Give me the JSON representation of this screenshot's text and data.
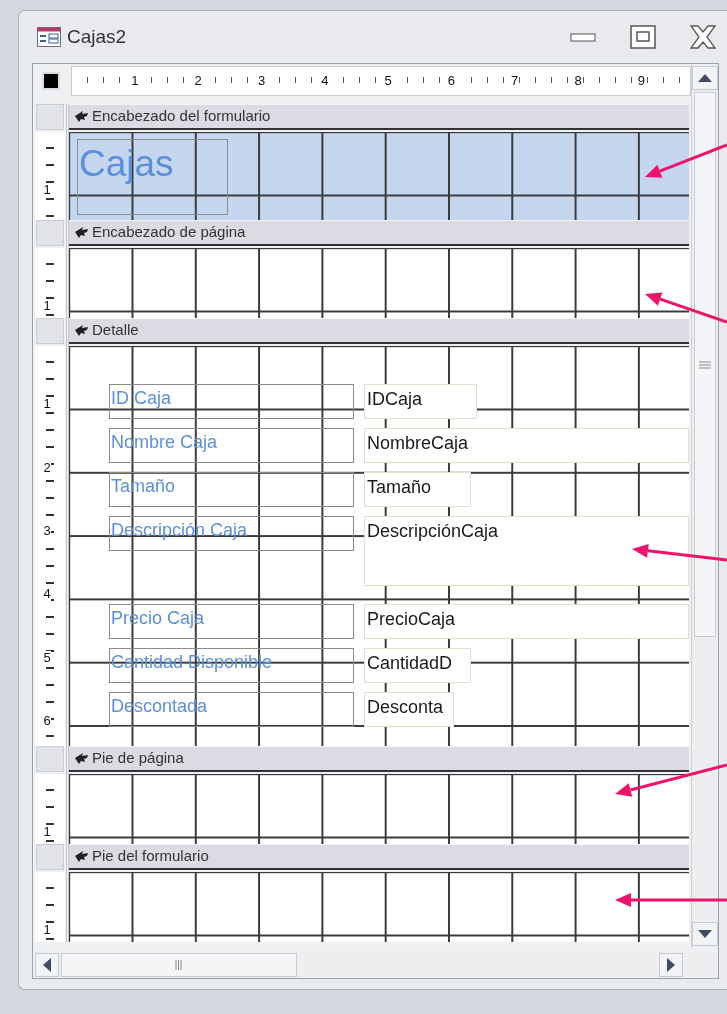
{
  "window": {
    "title": "Cajas2"
  },
  "ruler": {
    "marks": [
      "1",
      "2",
      "3",
      "4",
      "5",
      "6",
      "7",
      "8",
      "9"
    ]
  },
  "sections": [
    {
      "kind": "form_header",
      "title": "Encabezado del formulario",
      "selected": true,
      "ruler_marks": [
        "1"
      ],
      "title_label": "Cajas"
    },
    {
      "kind": "page_header",
      "title": "Encabezado de página",
      "selected": false,
      "ruler_marks": [
        "1"
      ]
    },
    {
      "kind": "detail",
      "title": "Detalle",
      "selected": false,
      "ruler_marks": [
        "1",
        "2",
        "3",
        "4",
        "5",
        "6"
      ],
      "controls": [
        {
          "label": "ID Caja",
          "field": "IDCaja"
        },
        {
          "label": "Nombre Caja",
          "field": "NombreCaja"
        },
        {
          "label": "Tamaño",
          "field": "Tamaño"
        },
        {
          "label": "Descripción Caja",
          "field": "DescripciónCaja"
        },
        {
          "label": "Precio Caja",
          "field": "PrecioCaja"
        },
        {
          "label": "Cantidad Disponible",
          "field": "CantidadD"
        },
        {
          "label": "Descontada",
          "field": "Desconta"
        }
      ]
    },
    {
      "kind": "page_footer",
      "title": "Pie de página",
      "selected": false,
      "ruler_marks": [
        "1"
      ]
    },
    {
      "kind": "form_footer",
      "title": "Pie del formulario",
      "selected": false,
      "ruler_marks": [
        "1"
      ]
    }
  ]
}
